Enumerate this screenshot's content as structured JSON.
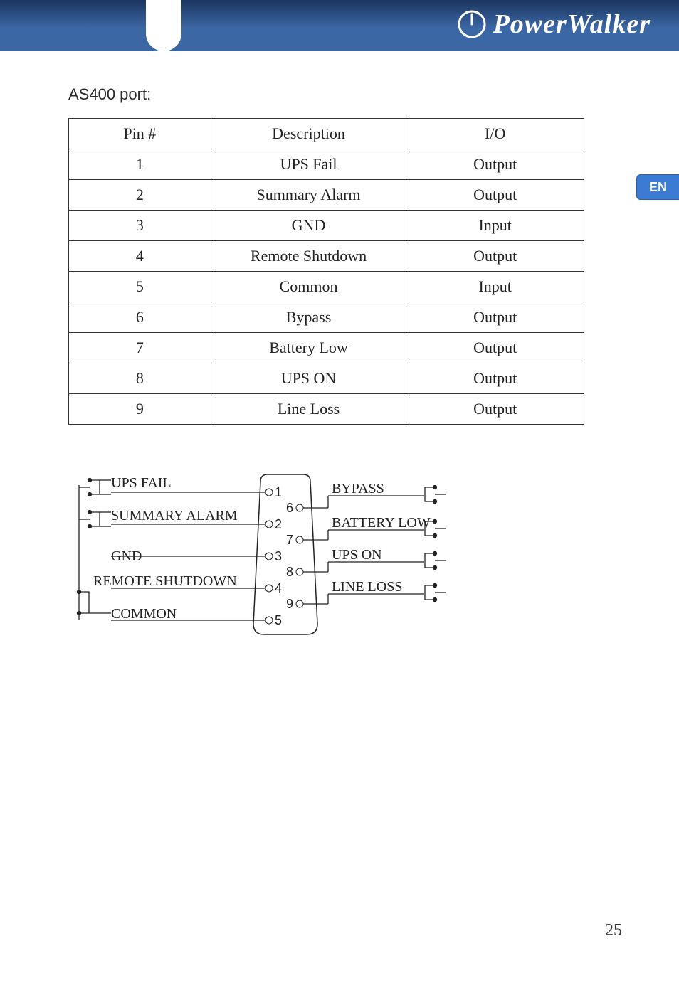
{
  "brand": "PowerWalker",
  "lang_tab": "EN",
  "section_title": "AS400 port:",
  "table": {
    "headers": {
      "pin": "Pin #",
      "desc": "Description",
      "io": "I/O"
    },
    "rows": [
      {
        "pin": "1",
        "desc": "UPS Fail",
        "io": "Output"
      },
      {
        "pin": "2",
        "desc": "Summary Alarm",
        "io": "Output"
      },
      {
        "pin": "3",
        "desc": "GND",
        "io": "Input"
      },
      {
        "pin": "4",
        "desc": "Remote Shutdown",
        "io": "Output"
      },
      {
        "pin": "5",
        "desc": "Common",
        "io": "Input"
      },
      {
        "pin": "6",
        "desc": "Bypass",
        "io": "Output"
      },
      {
        "pin": "7",
        "desc": "Battery Low",
        "io": "Output"
      },
      {
        "pin": "8",
        "desc": "UPS ON",
        "io": "Output"
      },
      {
        "pin": "9",
        "desc": "Line Loss",
        "io": "Output"
      }
    ]
  },
  "diagram": {
    "left_labels": [
      "UPS FAIL",
      "SUMMARY ALARM",
      "GND",
      "REMOTE SHUTDOWN",
      "COMMON"
    ],
    "right_labels": [
      "BYPASS",
      "BATTERY LOW",
      "UPS ON",
      "LINE LOSS"
    ],
    "left_pins": [
      "1",
      "2",
      "3",
      "4",
      "5"
    ],
    "right_pins": [
      "6",
      "7",
      "8",
      "9"
    ]
  },
  "page_number": "25"
}
